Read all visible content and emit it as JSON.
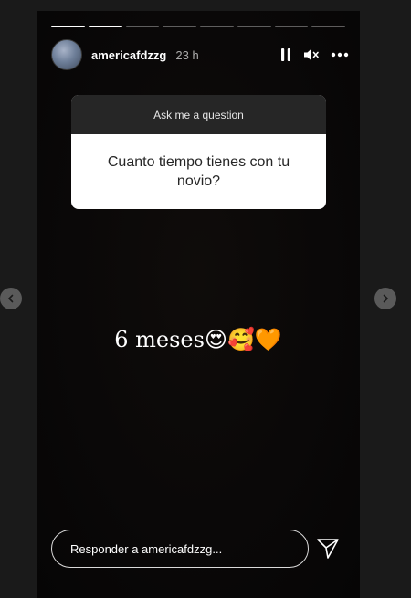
{
  "story": {
    "progress": {
      "total_segments": 8,
      "completed_segments": 2
    },
    "header": {
      "username": "americafdzzg",
      "time": "23 h",
      "avatar_icon": "avatar-photo"
    },
    "question": {
      "prompt": "Ask me a question",
      "text": "Cuanto tiempo tienes con tu novio?"
    },
    "answer": {
      "text": "6 meses",
      "emojis": [
        "😍",
        "🥰",
        "🧡"
      ]
    },
    "reply": {
      "placeholder": "Responder a americafdzzg..."
    }
  },
  "colors": {
    "background": "#1a1a1a",
    "story_bg": "#0a0808",
    "question_header": "#262626",
    "heart": "#f5891f"
  }
}
